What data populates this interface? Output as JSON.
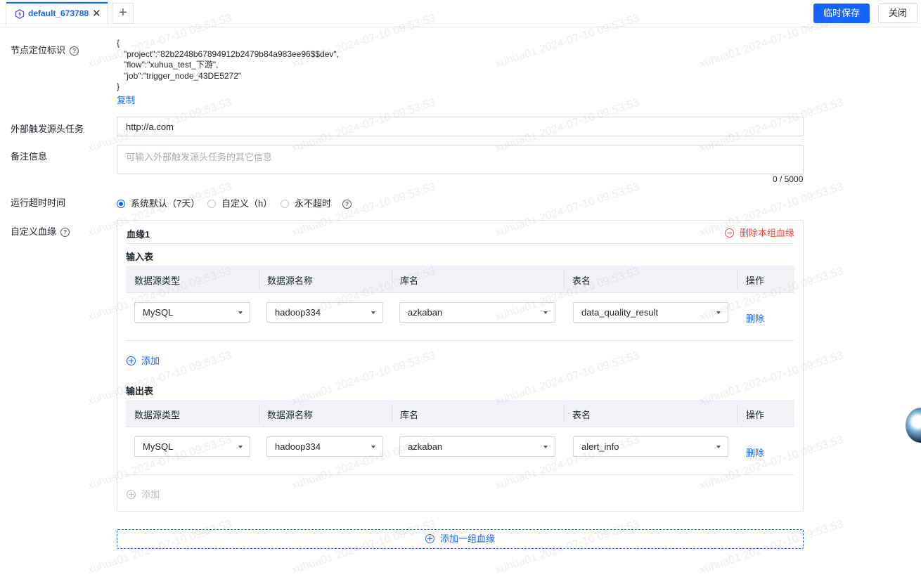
{
  "tabs": [
    {
      "label": "default_673788"
    }
  ],
  "toolbar": {
    "save_label": "临时保存",
    "close_label": "关闭",
    "add_tab": "+",
    "tab_close": "✕"
  },
  "form": {
    "node_id": {
      "label": "节点定位标识",
      "code": "{\n   \"project\":\"82b2248b67894912b2479b84a983ee96$$dev\",\n   \"flow\":\"xuhua_test_下游\",\n   \"job\":\"trigger_node_43DE5272\"\n}",
      "copy_label": "复制"
    },
    "source_task": {
      "label": "外部触发源头任务",
      "value": "http://a.com"
    },
    "remark": {
      "label": "备注信息",
      "placeholder": "可输入外部触发源头任务的其它信息",
      "counter": "0 / 5000"
    },
    "timeout": {
      "label": "运行超时时间",
      "options": [
        {
          "label": "系统默认（7天）",
          "selected": true
        },
        {
          "label": "自定义（h）",
          "selected": false
        },
        {
          "label": "永不超时",
          "selected": false
        }
      ]
    },
    "lineage_label": "自定义血缘"
  },
  "lineage": {
    "group_title": "血缘1",
    "delete_group": "删除本组血缘",
    "columns": [
      "数据源类型",
      "数据源名称",
      "库名",
      "表名",
      "操作"
    ],
    "input_title": "输入表",
    "input_rows": [
      {
        "type": "MySQL",
        "source": "hadoop334",
        "db": "azkaban",
        "table": "data_quality_result",
        "action": "删除"
      }
    ],
    "input_add": "添加",
    "output_title": "输出表",
    "output_rows": [
      {
        "type": "MySQL",
        "source": "hadoop334",
        "db": "azkaban",
        "table": "alert_info",
        "action": "删除"
      }
    ],
    "output_add": "添加",
    "add_group": "添加一组血缘"
  },
  "watermark": "xuhua01 2024-07-10 09:53:53",
  "colors": {
    "accent": "#1664ff",
    "danger": "#f54a45",
    "border": "#e4e6eb",
    "header_bg": "#f1f3f6"
  }
}
